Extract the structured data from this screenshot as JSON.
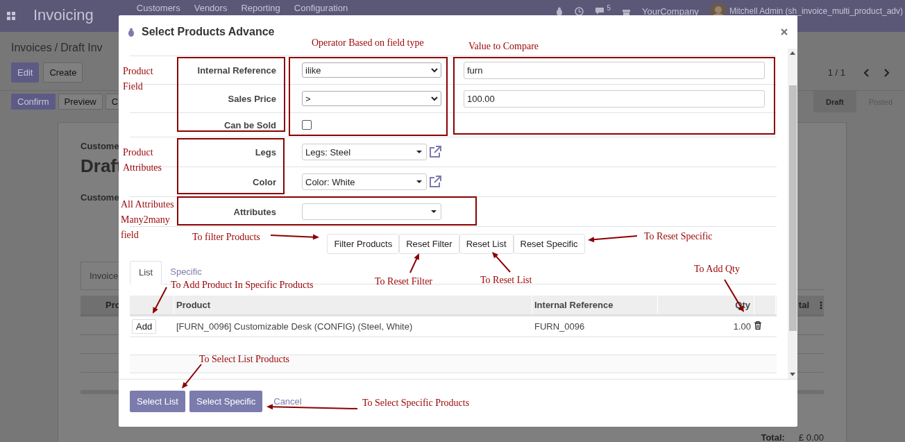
{
  "navbar": {
    "title": "Invoicing",
    "menu": [
      "Customers",
      "Vendors",
      "Reporting",
      "Configuration"
    ],
    "messages_count": "5",
    "company": "YourCompany",
    "user": "Mitchell Admin (sh_invoice_multi_product_adv)"
  },
  "control_panel": {
    "breadcrumb": [
      "Invoices",
      "Draft Inv"
    ],
    "separator": "/",
    "buttons": [
      "Edit",
      "Create"
    ],
    "pager": "1 / 1",
    "actions": [
      "Confirm",
      "Preview",
      "C"
    ],
    "statuses": [
      {
        "label": "Draft",
        "selected": true
      },
      {
        "label": "Posted",
        "selected": false
      }
    ]
  },
  "sheet": {
    "customer_label": "Custome",
    "title": "Draft",
    "customer_field": "Custome",
    "tab": "Invoice",
    "column_left": "Pro",
    "column_right": "tal",
    "total_label": "Total:",
    "total": "£ 0.00"
  },
  "dialog": {
    "title": "Select Products Advance",
    "field_rows": [
      {
        "kind": "text",
        "label": "Internal Reference",
        "operator": "ilike",
        "value": "furn"
      },
      {
        "kind": "text",
        "label": "Sales Price",
        "operator": ">",
        "value": "100.00"
      },
      {
        "kind": "checkbox",
        "label": "Can be Sold",
        "checked": false
      }
    ],
    "attribute_rows": [
      {
        "label": "Legs",
        "value": "Legs: Steel"
      },
      {
        "label": "Color",
        "value": "Color: White"
      }
    ],
    "attributes_label": "Attributes",
    "buttons": [
      "Filter Products",
      "Reset Filter",
      "Reset List",
      "Reset Specific"
    ],
    "tabs": [
      {
        "label": "List",
        "selected": true
      },
      {
        "label": "Specific",
        "selected": false
      }
    ],
    "columns": [
      "Product",
      "Internal Reference",
      "Qty"
    ],
    "rows": [
      {
        "action": "Add",
        "product": "[FURN_0096] Customizable Desk (CONFIG) (Steel, White)",
        "reference": "FURN_0096",
        "qty": "1.00"
      }
    ],
    "footer_buttons": [
      "Select List",
      "Select Specific"
    ],
    "cancel": "Cancel"
  },
  "annotations": [
    "Operator Based on field type",
    "Value to Compare",
    "Product Field",
    "Product Attributes",
    "All Attributes Many2many field",
    "To filter Products",
    "To Reset Specific",
    "To Reset Filter",
    "To Reset List",
    "To Add Qty",
    "To Add Product In Specific Products",
    "To Select List Products",
    "To Select Specific Products"
  ]
}
